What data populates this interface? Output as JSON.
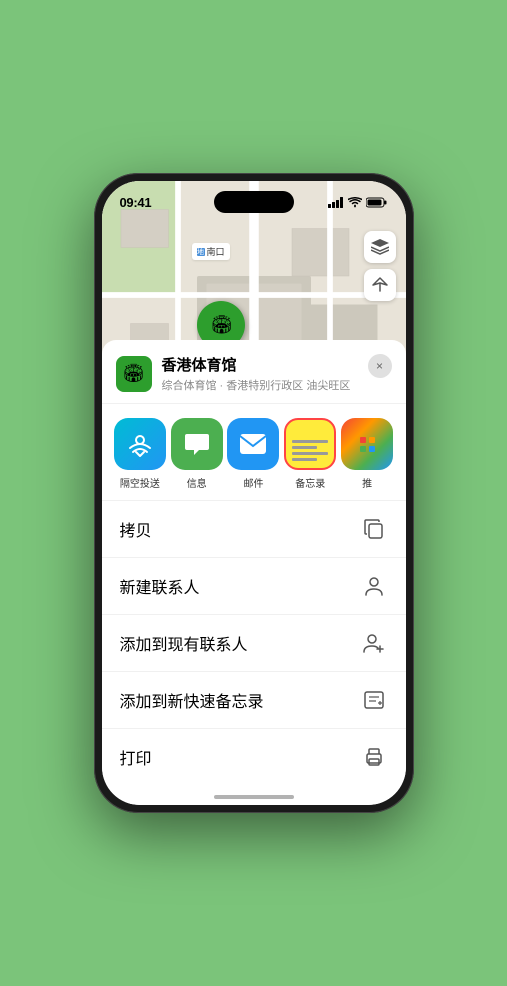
{
  "status_bar": {
    "time": "09:41",
    "signal": "signal-icon",
    "wifi": "wifi-icon",
    "battery": "battery-icon",
    "location": "location-arrow-icon"
  },
  "map": {
    "label": "南口",
    "pin_label": "香港体育馆",
    "map_type_icon": "map-layers-icon",
    "location_icon": "location-arrow-icon"
  },
  "venue": {
    "name": "香港体育馆",
    "description": "综合体育馆 · 香港特别行政区 油尖旺区",
    "close_label": "×"
  },
  "share_apps": [
    {
      "id": "airdrop",
      "label": "隔空投送",
      "type": "airdrop"
    },
    {
      "id": "messages",
      "label": "信息",
      "type": "messages"
    },
    {
      "id": "mail",
      "label": "邮件",
      "type": "mail"
    },
    {
      "id": "notes",
      "label": "备忘录",
      "type": "notes"
    },
    {
      "id": "more",
      "label": "推",
      "type": "more"
    }
  ],
  "actions": [
    {
      "id": "copy",
      "label": "拷贝",
      "icon": "copy-icon"
    },
    {
      "id": "new-contact",
      "label": "新建联系人",
      "icon": "person-icon"
    },
    {
      "id": "add-contact",
      "label": "添加到现有联系人",
      "icon": "person-add-icon"
    },
    {
      "id": "quick-note",
      "label": "添加到新快速备忘录",
      "icon": "quick-note-icon"
    },
    {
      "id": "print",
      "label": "打印",
      "icon": "print-icon"
    }
  ]
}
